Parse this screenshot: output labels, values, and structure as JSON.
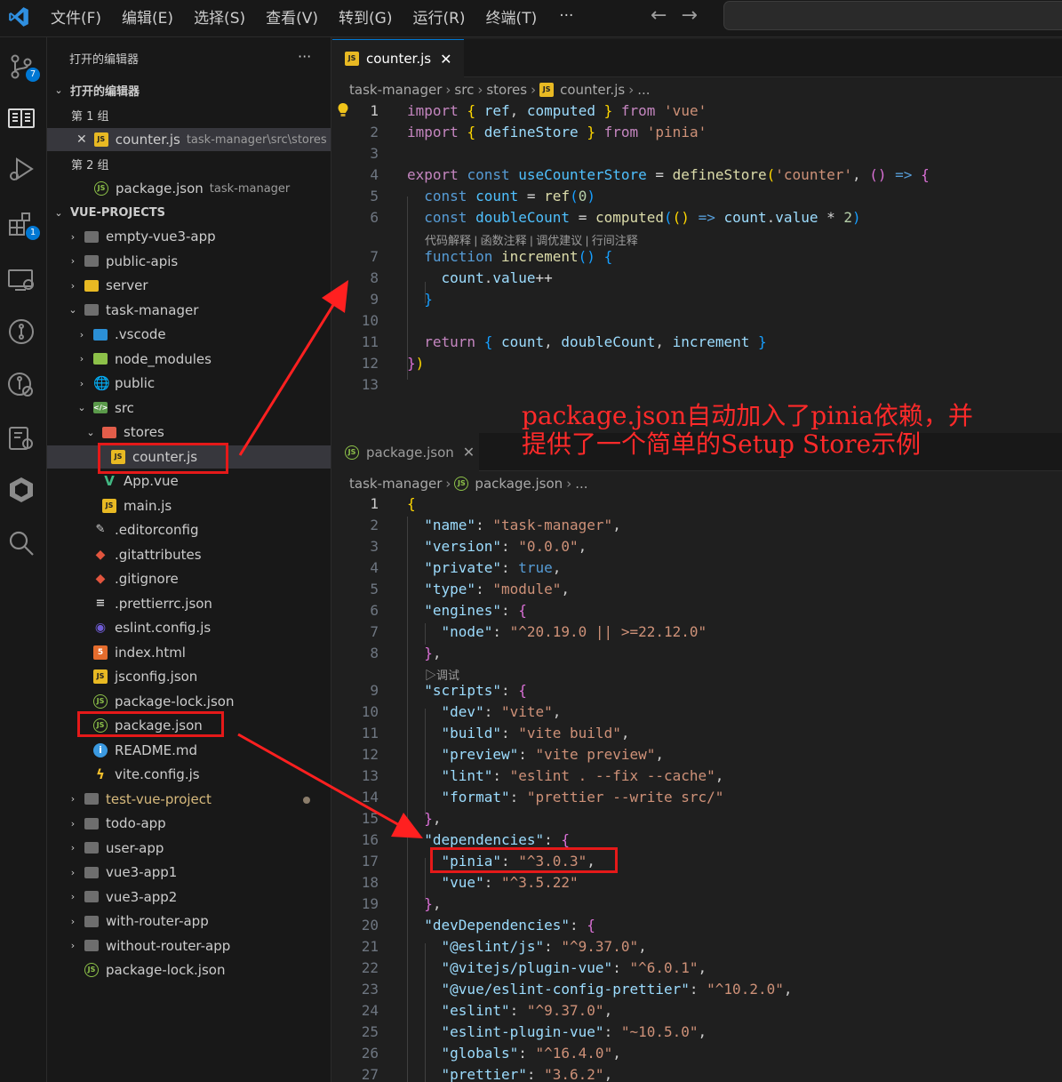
{
  "menu": {
    "items": [
      "文件(F)",
      "编辑(E)",
      "选择(S)",
      "查看(V)",
      "转到(G)",
      "运行(R)",
      "终端(T)"
    ],
    "more": "···"
  },
  "activity": {
    "scm_badge": "7",
    "extensions_badge": "1",
    "icons": [
      "source-control-icon",
      "explorer-icon",
      "run-debug-icon",
      "extensions-icon",
      "remote-explorer-icon",
      "git-graph-icon",
      "git-lens-icon",
      "docker-icon",
      "package-icon",
      "search-icon"
    ]
  },
  "sidebar": {
    "title": "打开的编辑器",
    "title_more": "···",
    "open_editors_header": "打开的编辑器",
    "group1": "第 1 组",
    "group1_file": "counter.js",
    "group1_path": "task-manager\\src\\stores",
    "group2": "第 2 组",
    "group2_file": "package.json",
    "group2_path": "task-manager",
    "workspace_header": "VUE-PROJECTS",
    "tree": [
      {
        "label": "empty-vue3-app",
        "icon": "folder",
        "chev": "›"
      },
      {
        "label": "public-apis",
        "icon": "folder",
        "chev": "›"
      },
      {
        "label": "server",
        "icon": "server",
        "chev": "›"
      },
      {
        "label": "task-manager",
        "icon": "folder",
        "chev": "⌄"
      },
      {
        "label": ".vscode",
        "icon": "vscode",
        "chev": "›"
      },
      {
        "label": "node_modules",
        "icon": "node",
        "chev": "›"
      },
      {
        "label": "public",
        "icon": "public",
        "chev": "›"
      },
      {
        "label": "src",
        "icon": "src",
        "chev": "⌄"
      },
      {
        "label": "stores",
        "icon": "stores",
        "chev": "⌄"
      },
      {
        "label": "counter.js",
        "icon": "js",
        "chev": ""
      },
      {
        "label": "App.vue",
        "icon": "vue",
        "chev": ""
      },
      {
        "label": "main.js",
        "icon": "js",
        "chev": ""
      },
      {
        "label": ".editorconfig",
        "icon": "edit",
        "chev": ""
      },
      {
        "label": ".gitattributes",
        "icon": "git",
        "chev": ""
      },
      {
        "label": ".gitignore",
        "icon": "git",
        "chev": ""
      },
      {
        "label": ".prettierrc.json",
        "icon": "prettier",
        "chev": ""
      },
      {
        "label": "eslint.config.js",
        "icon": "eslint",
        "chev": ""
      },
      {
        "label": "index.html",
        "icon": "html",
        "chev": ""
      },
      {
        "label": "jsconfig.json",
        "icon": "jsjson",
        "chev": ""
      },
      {
        "label": "package-lock.json",
        "icon": "json",
        "chev": ""
      },
      {
        "label": "package.json",
        "icon": "json",
        "chev": ""
      },
      {
        "label": "README.md",
        "icon": "info",
        "chev": ""
      },
      {
        "label": "vite.config.js",
        "icon": "vite",
        "chev": ""
      },
      {
        "label": "test-vue-project",
        "icon": "folder",
        "chev": "›"
      },
      {
        "label": "todo-app",
        "icon": "folder",
        "chev": "›"
      },
      {
        "label": "user-app",
        "icon": "folder",
        "chev": "›"
      },
      {
        "label": "vue3-app1",
        "icon": "folder",
        "chev": "›"
      },
      {
        "label": "vue3-app2",
        "icon": "folder",
        "chev": "›"
      },
      {
        "label": "with-router-app",
        "icon": "folder",
        "chev": "›"
      },
      {
        "label": "without-router-app",
        "icon": "folder",
        "chev": "›"
      },
      {
        "label": "package-lock.json",
        "icon": "json",
        "chev": ""
      }
    ]
  },
  "editor1": {
    "tab": "counter.js",
    "tab_close": "✕",
    "breadcrumb": [
      "task-manager",
      "src",
      "stores",
      "counter.js",
      "..."
    ],
    "codelens": "代码解释 | 函数注释 | 调优建议 | 行间注释",
    "line_numbers": [
      "1",
      "2",
      "3",
      "4",
      "5",
      "6",
      "7",
      "8",
      "9",
      "10",
      "11",
      "12",
      "13"
    ]
  },
  "editor2": {
    "tab": "package.json",
    "tab_close": "✕",
    "breadcrumb": [
      "task-manager",
      "package.json",
      "..."
    ],
    "debug_lens": "▷调试",
    "line_numbers": [
      "1",
      "2",
      "3",
      "4",
      "5",
      "6",
      "7",
      "8",
      "9",
      "10",
      "11",
      "12",
      "13",
      "14",
      "15",
      "16",
      "17",
      "18",
      "19",
      "20",
      "21",
      "22",
      "23",
      "24",
      "25",
      "26",
      "27"
    ]
  },
  "annotation": {
    "line1": "package.json自动加入了pinia依赖，并",
    "line2": "提供了一个简单的Setup Store示例"
  },
  "colors": {
    "accent": "#0078d4",
    "highlight_red": "#e51919",
    "annotation_red": "#ff2a2a"
  }
}
